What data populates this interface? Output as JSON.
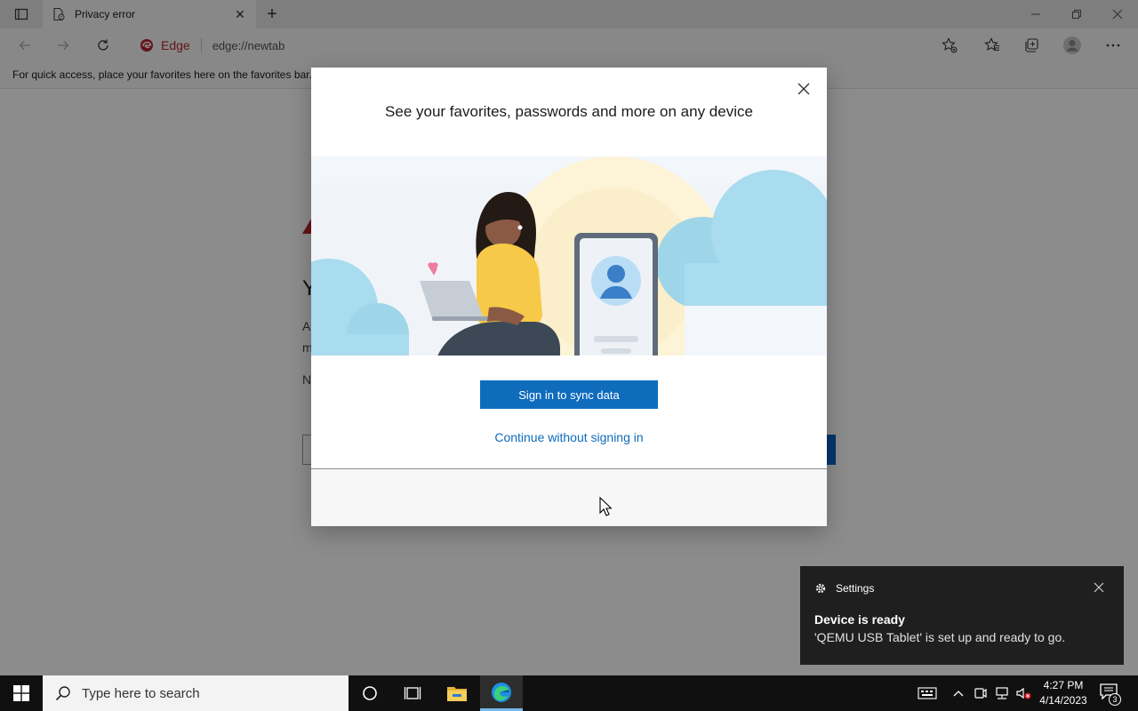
{
  "browser": {
    "tab": {
      "title": "Privacy error",
      "close_glyph": "✕"
    },
    "new_tab_glyph": "+",
    "address": {
      "badge": "Edge",
      "url": "edge://newtab"
    },
    "favorites_bar_text": "For quick access, place your favorites here on the favorites bar."
  },
  "page": {
    "heading_partial": "Y",
    "line1_partial": "A",
    "line2_partial": "m",
    "line3_partial": "N"
  },
  "modal": {
    "title": "See your favorites, passwords and more on any device",
    "primary_button": "Sign in to sync data",
    "secondary_link": "Continue without signing in"
  },
  "toast": {
    "app_name": "Settings",
    "title": "Device is ready",
    "body": "'QEMU USB Tablet' is set up and ready to go."
  },
  "taskbar": {
    "search_placeholder": "Type here to search",
    "time": "4:27 PM",
    "date": "4/14/2023",
    "notification_count": "3"
  },
  "colors": {
    "accent_blue": "#0f6cbd",
    "edge_red": "#b7262c",
    "toast_bg": "#1f1f1f",
    "taskbar_bg": "#101010"
  },
  "icons": [
    "tab-actions-icon",
    "page-icon",
    "close-icon",
    "plus-icon",
    "back-arrow-icon",
    "forward-arrow-icon",
    "refresh-icon",
    "edge-logo-icon",
    "add-favorite-icon",
    "favorites-icon",
    "collections-icon",
    "profile-icon",
    "more-icon",
    "gear-icon",
    "windows-logo-icon",
    "search-icon",
    "cortana-icon",
    "task-view-icon",
    "file-explorer-icon",
    "edge-icon",
    "keyboard-icon",
    "chevron-up-icon",
    "meet-now-icon",
    "network-icon",
    "volume-muted-icon",
    "notification-icon"
  ]
}
